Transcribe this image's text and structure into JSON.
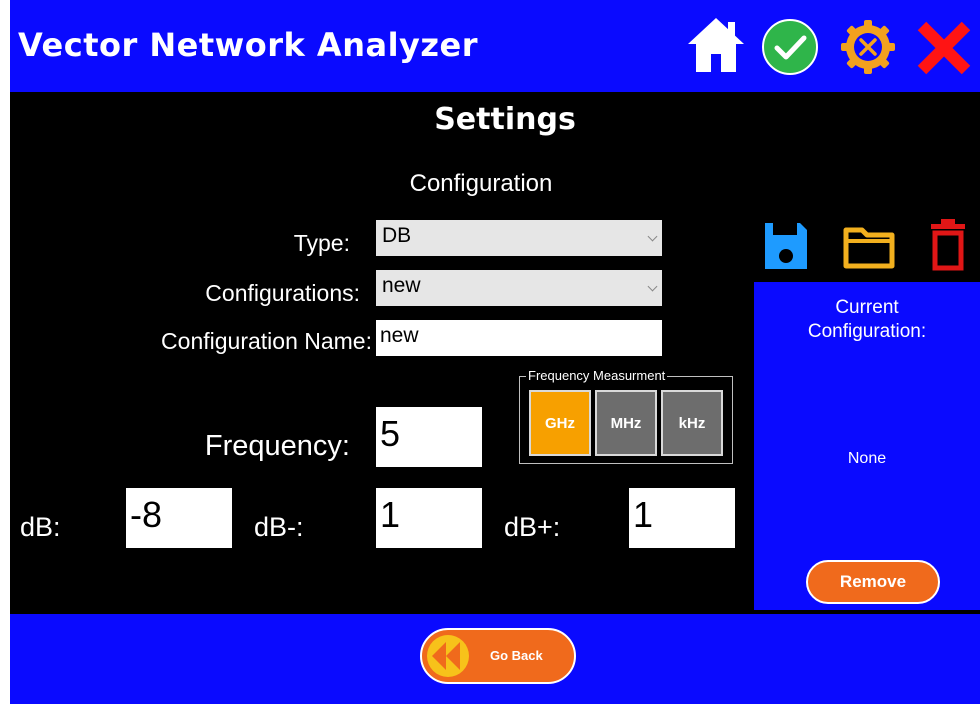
{
  "app": {
    "title": "Vector Network Analyzer"
  },
  "header_icons": [
    "home-icon",
    "check-icon",
    "tools-gear-icon",
    "close-icon"
  ],
  "settings": {
    "heading": "Settings",
    "section": "Configuration",
    "type_label": "Type:",
    "type_value": "DB",
    "configurations_label": "Configurations:",
    "configurations_value": "new",
    "config_name_label": "Configuration Name:",
    "config_name_value": "new",
    "frequency_label": "Frequency:",
    "frequency_value": "5",
    "freq_measurement": {
      "legend": "Frequency Measurment",
      "options": [
        "GHz",
        "MHz",
        "kHz"
      ],
      "selected": "GHz"
    },
    "db_label": "dB:",
    "db_value": "-8",
    "db_minus_label": "dB-:",
    "db_minus_value": "1",
    "db_plus_label": "dB+:",
    "db_plus_value": "1"
  },
  "file_icons": [
    "save-icon",
    "folder-icon",
    "trash-icon"
  ],
  "current_config": {
    "title": "Current Configuration:",
    "value": "None",
    "remove_label": "Remove"
  },
  "footer": {
    "go_back_label": "Go Back"
  },
  "colors": {
    "header_blue": "#0a0aff",
    "selected_orange": "#f7a000",
    "button_orange": "#f06a1c",
    "unselected_gray": "#6d6d6d"
  }
}
